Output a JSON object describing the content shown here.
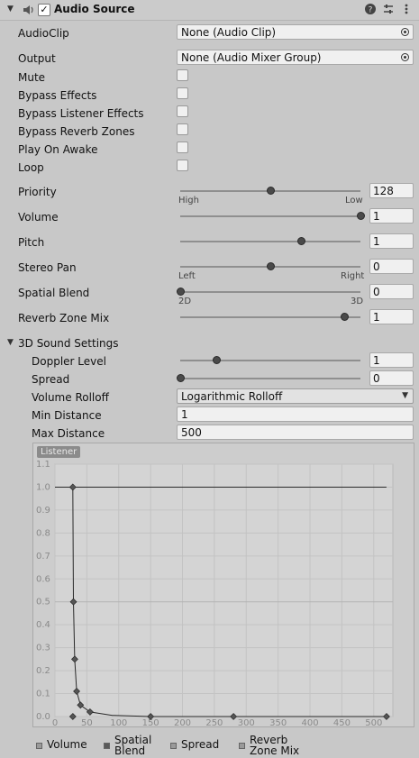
{
  "component": {
    "title": "Audio Source",
    "enabled": true
  },
  "fields": {
    "audio_clip": {
      "label": "AudioClip",
      "value": "None (Audio Clip)"
    },
    "output": {
      "label": "Output",
      "value": "None (Audio Mixer Group)"
    },
    "mute": {
      "label": "Mute",
      "checked": false
    },
    "bypass_effects": {
      "label": "Bypass Effects",
      "checked": false
    },
    "bypass_listener_effects": {
      "label": "Bypass Listener Effects",
      "checked": false
    },
    "bypass_reverb_zones": {
      "label": "Bypass Reverb Zones",
      "checked": false
    },
    "play_on_awake": {
      "label": "Play On Awake",
      "checked": false
    },
    "loop": {
      "label": "Loop",
      "checked": false
    },
    "priority": {
      "label": "Priority",
      "value": "128",
      "fraction": 0.5,
      "min_label": "High",
      "max_label": "Low"
    },
    "volume": {
      "label": "Volume",
      "value": "1",
      "fraction": 1.0
    },
    "pitch": {
      "label": "Pitch",
      "value": "1",
      "fraction": 0.67
    },
    "stereo_pan": {
      "label": "Stereo Pan",
      "value": "0",
      "fraction": 0.5,
      "min_label": "Left",
      "max_label": "Right"
    },
    "spatial_blend": {
      "label": "Spatial Blend",
      "value": "0",
      "fraction": 0.0,
      "min_label": "2D",
      "max_label": "3D"
    },
    "reverb_zone_mix": {
      "label": "Reverb Zone Mix",
      "value": "1",
      "fraction": 0.91
    }
  },
  "sound3d": {
    "header": "3D Sound Settings",
    "doppler_level": {
      "label": "Doppler Level",
      "value": "1",
      "fraction": 0.2
    },
    "spread": {
      "label": "Spread",
      "value": "0",
      "fraction": 0.0
    },
    "volume_rolloff": {
      "label": "Volume Rolloff",
      "value": "Logarithmic Rolloff"
    },
    "min_distance": {
      "label": "Min Distance",
      "value": "1"
    },
    "max_distance": {
      "label": "Max Distance",
      "value": "500"
    }
  },
  "chart_data": {
    "type": "line",
    "badge": "Listener",
    "x_ticks": [
      "0",
      "50",
      "100",
      "150",
      "200",
      "250",
      "300",
      "350",
      "400",
      "450",
      "500"
    ],
    "y_ticks": [
      "0.0",
      "0.1",
      "0.2",
      "0.3",
      "0.4",
      "0.5",
      "0.6",
      "0.7",
      "0.8",
      "0.9",
      "1.0",
      "1.1"
    ],
    "xlim": [
      0,
      530
    ],
    "ylim": [
      0,
      1.1
    ],
    "series": [
      {
        "name": "Volume",
        "points": [
          [
            28,
            1.0
          ],
          [
            29,
            0.5
          ],
          [
            31,
            0.25
          ],
          [
            34,
            0.11
          ],
          [
            40,
            0.05
          ],
          [
            55,
            0.02
          ],
          [
            90,
            0.005
          ],
          [
            150,
            0.0
          ],
          [
            280,
            0.0
          ],
          [
            520,
            0.0
          ]
        ]
      },
      {
        "name": "Spatial Blend",
        "points": [
          [
            0,
            1.0
          ],
          [
            520,
            1.0
          ]
        ]
      }
    ],
    "markers": [
      [
        28,
        1.0
      ],
      [
        29,
        0.5
      ],
      [
        31,
        0.25
      ],
      [
        34,
        0.11
      ],
      [
        40,
        0.05
      ],
      [
        55,
        0.02
      ],
      [
        150,
        0.0
      ],
      [
        280,
        0.0
      ],
      [
        520,
        0.0
      ],
      [
        28,
        0.0
      ]
    ],
    "legend": [
      {
        "label": "Volume",
        "color": "#9a9a9a"
      },
      {
        "label": "Spatial\nBlend",
        "color": "#5a5a5a"
      },
      {
        "label": "Spread",
        "color": "#9a9a9a"
      },
      {
        "label": "Reverb\nZone Mix",
        "color": "#9a9a9a"
      }
    ]
  }
}
